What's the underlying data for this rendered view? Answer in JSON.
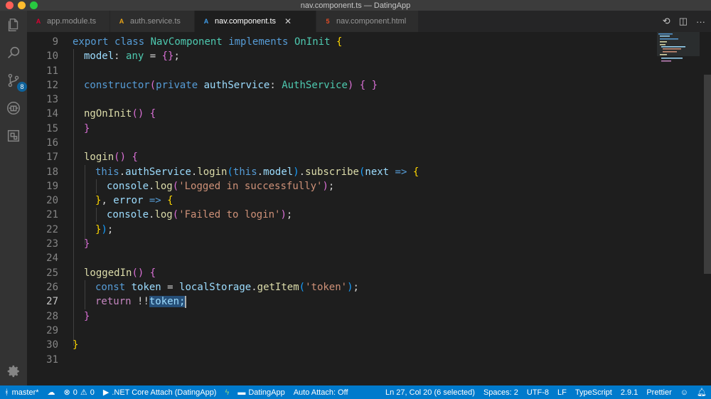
{
  "window": {
    "title": "nav.component.ts — DatingApp"
  },
  "activity": {
    "scm_badge": "8"
  },
  "tabs": [
    {
      "label": "app.module.ts",
      "icon": "angular-icon",
      "icon_glyph": "A",
      "color": "#dd0031"
    },
    {
      "label": "auth.service.ts",
      "icon": "angular-icon",
      "icon_glyph": "A",
      "color": "#e8a317"
    },
    {
      "label": "nav.component.ts",
      "icon": "angular-icon",
      "icon_glyph": "A",
      "color": "#3f9ce8",
      "close": "✕"
    },
    {
      "label": "nav.component.html",
      "icon": "html5-icon",
      "icon_glyph": "5",
      "color": "#e44d26"
    }
  ],
  "editor": {
    "line_numbers": [
      "9",
      "10",
      "11",
      "12",
      "13",
      "14",
      "15",
      "16",
      "17",
      "18",
      "19",
      "20",
      "21",
      "22",
      "23",
      "24",
      "25",
      "26",
      "27",
      "28",
      "29",
      "30",
      "31"
    ],
    "current_line": "27",
    "code": {
      "l9": {
        "export": "export",
        "class": "class",
        "name": "NavComponent",
        "implements": "implements",
        "iface": "OnInit",
        "brace": "{"
      },
      "l10": {
        "prop": "model",
        "colon": ": ",
        "type": "any",
        "eq": " = ",
        "obj": "{}",
        "semi": ";"
      },
      "l12": {
        "ctor": "constructor",
        "open": "(",
        "priv": "private",
        "param": "authService",
        "colon": ": ",
        "type": "AuthService",
        "close": ")",
        "braces": "{ }"
      },
      "l14": {
        "fn": "ngOnInit",
        "parens": "()",
        "brace": "{"
      },
      "l15": {
        "brace": "}"
      },
      "l17": {
        "fn": "login",
        "parens": "()",
        "brace": "{"
      },
      "l18": {
        "this": "this",
        "dot1": ".",
        "svc": "authService",
        "dot2": ".",
        "login": "login",
        "p1": "(",
        "this2": "this",
        "dot3": ".",
        "model": "model",
        "p2": ")",
        "dot4": ".",
        "sub": "subscribe",
        "p3": "(",
        "next": "next",
        "arrow": " => ",
        "brace": "{"
      },
      "l19": {
        "console": "console",
        "dot": ".",
        "log": "log",
        "p1": "(",
        "str": "'Logged in successfully'",
        "p2": ")",
        "semi": ";"
      },
      "l20": {
        "close": "}",
        "comma": ", ",
        "error": "error",
        "arrow": " => ",
        "brace": "{"
      },
      "l21": {
        "console": "console",
        "dot": ".",
        "log": "log",
        "p1": "(",
        "str": "'Failed to login'",
        "p2": ")",
        "semi": ";"
      },
      "l22": {
        "brace": "}",
        "paren": ")",
        "semi": ";"
      },
      "l23": {
        "brace": "}"
      },
      "l25": {
        "fn": "loggedIn",
        "parens": "()",
        "brace": "{"
      },
      "l26": {
        "const": "const",
        "var": "token",
        "eq": " = ",
        "ls": "localStorage",
        "dot": ".",
        "get": "getItem",
        "p1": "(",
        "str": "'token'",
        "p2": ")",
        "semi": ";"
      },
      "l27": {
        "ret": "return",
        "bang": "!!",
        "sel": "token;"
      },
      "l28": {
        "brace": "}"
      },
      "l30": {
        "brace": "}"
      }
    }
  },
  "status": {
    "branch": "master*",
    "errors": "0",
    "warnings": "0",
    "debug": ".NET Core Attach (DatingApp)",
    "folder": "DatingApp",
    "auto_attach": "Auto Attach: Off",
    "position": "Ln 27, Col 20 (6 selected)",
    "spaces": "Spaces: 2",
    "encoding": "UTF-8",
    "eol": "LF",
    "language": "TypeScript",
    "version": "2.9.1",
    "formatter": "Prettier"
  },
  "colors": {
    "statusbar": "#007acc",
    "selection": "#264f78",
    "editor_bg": "#1e1e1e"
  }
}
